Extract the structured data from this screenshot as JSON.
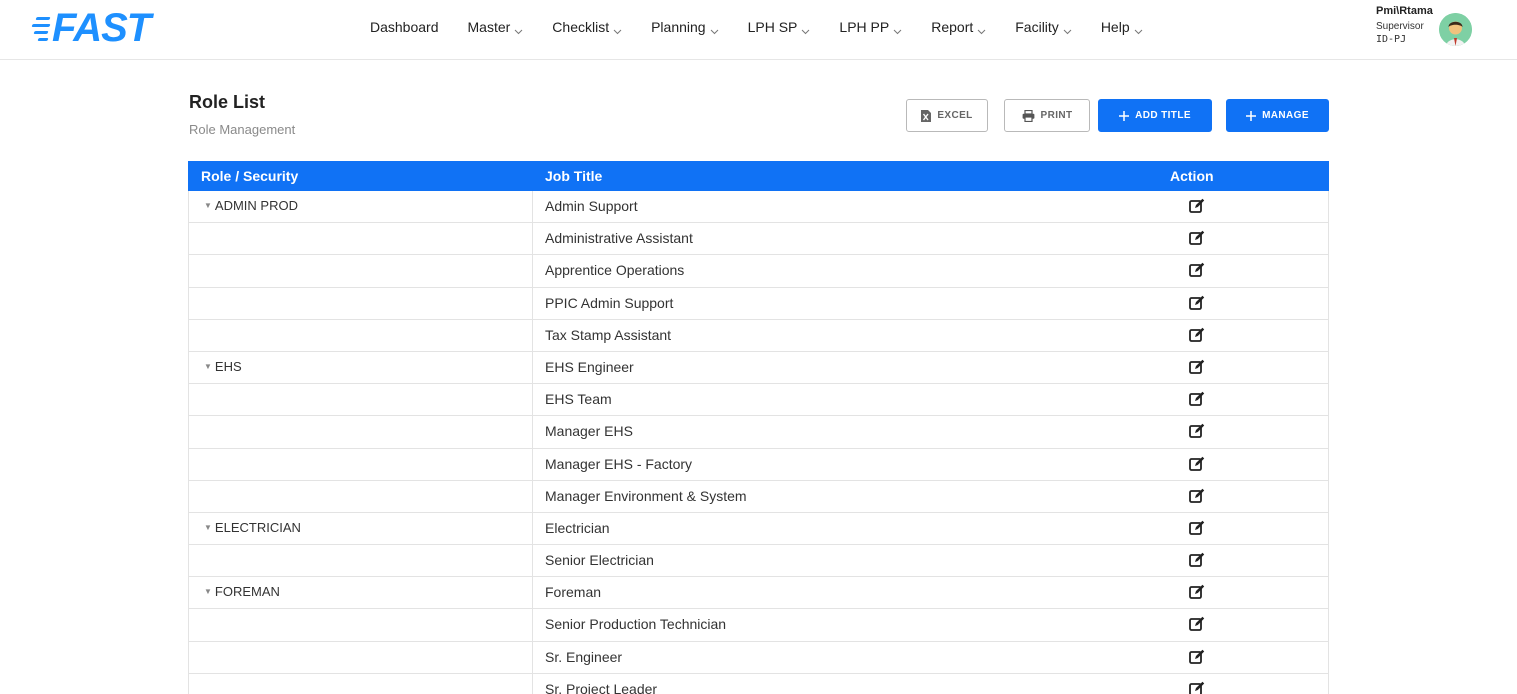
{
  "app": {
    "logo_text": "FAST"
  },
  "nav": [
    {
      "label": "Dashboard",
      "dropdown": false
    },
    {
      "label": "Master",
      "dropdown": true
    },
    {
      "label": "Checklist",
      "dropdown": true
    },
    {
      "label": "Planning",
      "dropdown": true
    },
    {
      "label": "LPH SP",
      "dropdown": true
    },
    {
      "label": "LPH PP",
      "dropdown": true
    },
    {
      "label": "Report",
      "dropdown": true
    },
    {
      "label": "Facility",
      "dropdown": true
    },
    {
      "label": "Help",
      "dropdown": true
    }
  ],
  "user": {
    "name": "Pmi\\Rtama",
    "role": "Supervisor",
    "site": "ID-PJ"
  },
  "page": {
    "title": "Role List",
    "subtitle": "Role Management"
  },
  "actions": {
    "excel": "EXCEL",
    "print": "PRINT",
    "add_title": "ADD TITLE",
    "manage": "MANAGE"
  },
  "table": {
    "headers": {
      "role": "Role / Security",
      "job": "Job Title",
      "action": "Action"
    },
    "rows": [
      {
        "role": "ADMIN PROD",
        "job": "Admin Support"
      },
      {
        "role": "",
        "job": "Administrative Assistant"
      },
      {
        "role": "",
        "job": "Apprentice Operations"
      },
      {
        "role": "",
        "job": "PPIC Admin Support"
      },
      {
        "role": "",
        "job": "Tax Stamp Assistant"
      },
      {
        "role": "EHS",
        "job": "EHS Engineer"
      },
      {
        "role": "",
        "job": "EHS Team"
      },
      {
        "role": "",
        "job": "Manager EHS"
      },
      {
        "role": "",
        "job": "Manager EHS - Factory"
      },
      {
        "role": "",
        "job": "Manager Environment & System"
      },
      {
        "role": "ELECTRICIAN",
        "job": "Electrician"
      },
      {
        "role": "",
        "job": "Senior Electrician"
      },
      {
        "role": "FOREMAN",
        "job": "Foreman"
      },
      {
        "role": "",
        "job": "Senior Production Technician"
      },
      {
        "role": "",
        "job": "Sr. Engineer"
      },
      {
        "role": "",
        "job": "Sr. Project Leader"
      }
    ]
  },
  "colors": {
    "primary": "#1072f5",
    "logo": "#1e90ff"
  }
}
